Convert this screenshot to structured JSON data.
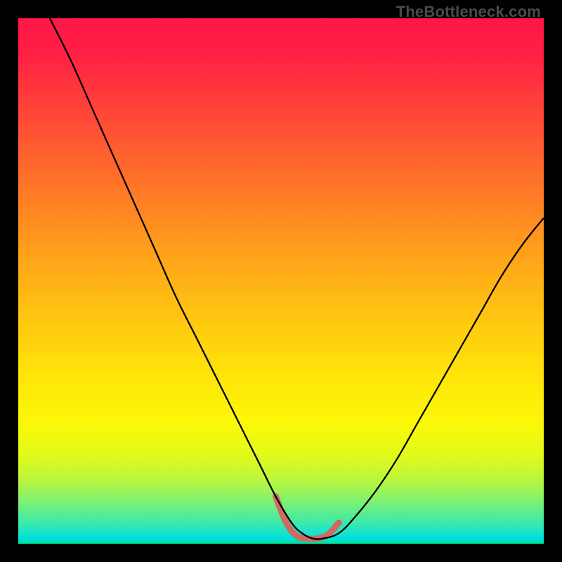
{
  "watermark": "TheBottleneck.com",
  "chart_data": {
    "type": "line",
    "title": "",
    "xlabel": "",
    "ylabel": "",
    "xlim": [
      0,
      100
    ],
    "ylim": [
      0,
      100
    ],
    "grid": false,
    "legend": false,
    "gradient_stops": [
      {
        "pct": 0,
        "color": "#ff1647"
      },
      {
        "pct": 6,
        "color": "#ff1e44"
      },
      {
        "pct": 14,
        "color": "#ff383c"
      },
      {
        "pct": 24,
        "color": "#ff5a31"
      },
      {
        "pct": 35,
        "color": "#ff8024"
      },
      {
        "pct": 46,
        "color": "#ffa519"
      },
      {
        "pct": 58,
        "color": "#ffc910"
      },
      {
        "pct": 69,
        "color": "#ffe709"
      },
      {
        "pct": 77,
        "color": "#fbf807"
      },
      {
        "pct": 83,
        "color": "#e4f91a"
      },
      {
        "pct": 88,
        "color": "#b9f63f"
      },
      {
        "pct": 92,
        "color": "#7df173"
      },
      {
        "pct": 96,
        "color": "#3de9ab"
      },
      {
        "pct": 98,
        "color": "#15e4cf"
      },
      {
        "pct": 99,
        "color": "#00e1e0"
      },
      {
        "pct": 100,
        "color": "#00e191"
      }
    ],
    "series": [
      {
        "name": "bottleneck-curve",
        "stroke": "#000000",
        "stroke_width": 2.3,
        "x": [
          6,
          10,
          14,
          18,
          22,
          26,
          30,
          34,
          38,
          42,
          46,
          49,
          52,
          54,
          56,
          58,
          61,
          64,
          68,
          72,
          76,
          80,
          84,
          88,
          92,
          96,
          100
        ],
        "y": [
          100,
          92,
          83,
          74,
          65,
          56,
          47,
          39,
          31,
          23,
          15,
          9,
          4,
          2,
          1,
          1,
          2,
          5,
          10,
          16,
          23,
          30,
          37,
          44,
          51,
          57,
          62
        ]
      },
      {
        "name": "flat-bottom-highlight",
        "stroke": "#cf6a62",
        "stroke_width": 9,
        "linecap": "round",
        "x": [
          49,
          51,
          53,
          55,
          57,
          59,
          61
        ],
        "y": [
          9,
          4,
          1.5,
          1,
          1,
          1.8,
          4
        ]
      }
    ]
  }
}
